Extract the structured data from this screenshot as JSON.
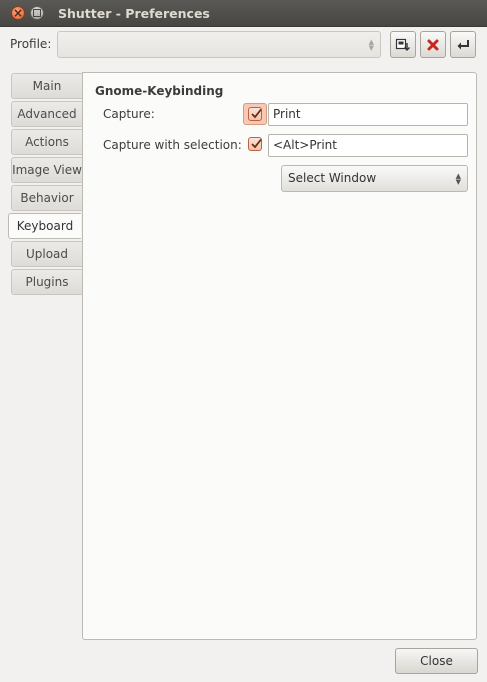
{
  "window": {
    "title": "Shutter - Preferences"
  },
  "profile": {
    "label": "Profile:",
    "value": "",
    "buttons": [
      {
        "name": "save-profile",
        "icon": "save-icon"
      },
      {
        "name": "delete-profile",
        "icon": "delete-icon"
      },
      {
        "name": "apply-profile",
        "icon": "enter-icon"
      }
    ]
  },
  "tabs": [
    "Main",
    "Advanced",
    "Actions",
    "Image View",
    "Behavior",
    "Keyboard",
    "Upload",
    "Plugins"
  ],
  "active_tab": "Keyboard",
  "keyboard": {
    "section_title": "Gnome-Keybinding",
    "capture": {
      "label": "Capture:",
      "checked": true,
      "value": "Print"
    },
    "capture_selection": {
      "label": "Capture with selection:",
      "checked": true,
      "value": "<Alt>Print"
    },
    "selection_mode": "Select Window"
  },
  "close_label": "Close",
  "colors": {
    "titlebar": "#4f4e4a",
    "accent": "#e0612c",
    "panel": "#fbfbfa"
  }
}
